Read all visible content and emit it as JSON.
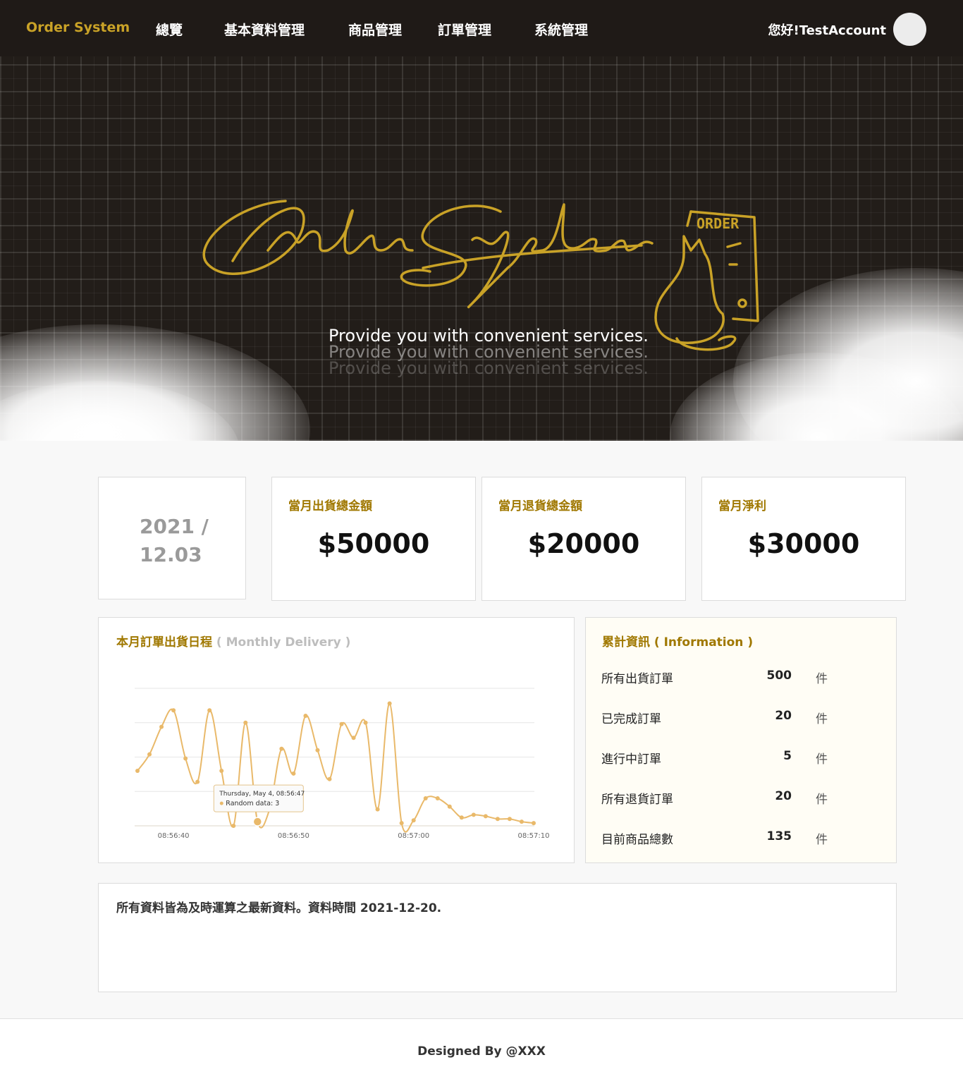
{
  "header": {
    "brand": "Order System",
    "nav": [
      "總覽",
      "基本資料管理",
      "商品管理",
      "訂單管理",
      "系統管理"
    ],
    "greeting": "您好!TestAccount"
  },
  "hero": {
    "tagline": "Provide you with convenient services.",
    "logo_script": "Order System",
    "logo_badge": "ORDER",
    "accent": "#c9a227"
  },
  "summary": {
    "date": "2021 / 12.03",
    "cards": [
      {
        "label": "當月出貨總金額",
        "value": "$50000"
      },
      {
        "label": "當月退貨總金額",
        "value": "$20000"
      },
      {
        "label": "當月淨利",
        "value": "$30000"
      }
    ]
  },
  "chart_panel": {
    "title": "本月訂單出貨日程",
    "subtitle": "( Monthly Delivery )",
    "tooltip_line1": "Thursday, May 4, 08:56:47",
    "tooltip_line2": "Random data: 3"
  },
  "chart_data": {
    "type": "line",
    "x": [
      "08:56:37",
      "08:56:38",
      "08:56:39",
      "08:56:40",
      "08:56:41",
      "08:56:42",
      "08:56:43",
      "08:56:44",
      "08:56:45",
      "08:56:46",
      "08:56:47",
      "08:56:48",
      "08:56:49",
      "08:56:50",
      "08:56:51",
      "08:56:52",
      "08:56:53",
      "08:56:54",
      "08:56:55",
      "08:56:56",
      "08:56:57",
      "08:56:58",
      "08:56:59",
      "08:57:00",
      "08:57:01",
      "08:57:02",
      "08:57:03",
      "08:57:04",
      "08:57:05",
      "08:57:06",
      "08:57:07",
      "08:57:08",
      "08:57:09",
      "08:57:10"
    ],
    "series": [
      {
        "name": "Random data",
        "values": [
          40,
          52,
          72,
          84,
          49,
          32,
          84,
          40,
          0,
          75,
          3,
          12,
          56,
          38,
          80,
          55,
          34,
          74,
          64,
          75,
          12,
          89,
          2,
          4,
          20,
          20,
          14,
          6,
          8,
          7,
          5,
          5,
          3,
          2
        ]
      }
    ],
    "xticks": [
      "08:56:40",
      "08:56:50",
      "08:57:00",
      "08:57:10"
    ],
    "ylim": [
      0,
      100
    ],
    "grid": true,
    "line_color": "#e9b96a"
  },
  "info": {
    "title": "累計資訊 ( Information )",
    "rows": [
      {
        "label": "所有出貨訂單",
        "value": "500",
        "unit": "件"
      },
      {
        "label": "已完成訂單",
        "value": "20",
        "unit": "件"
      },
      {
        "label": "進行中訂單",
        "value": "5",
        "unit": "件"
      },
      {
        "label": "所有退貨訂單",
        "value": "20",
        "unit": "件"
      },
      {
        "label": "目前商品總數",
        "value": "135",
        "unit": "件"
      }
    ]
  },
  "note": "所有資料皆為及時運算之最新資料。資料時間 2021-12-20.",
  "footer": "Designed By @XXX"
}
